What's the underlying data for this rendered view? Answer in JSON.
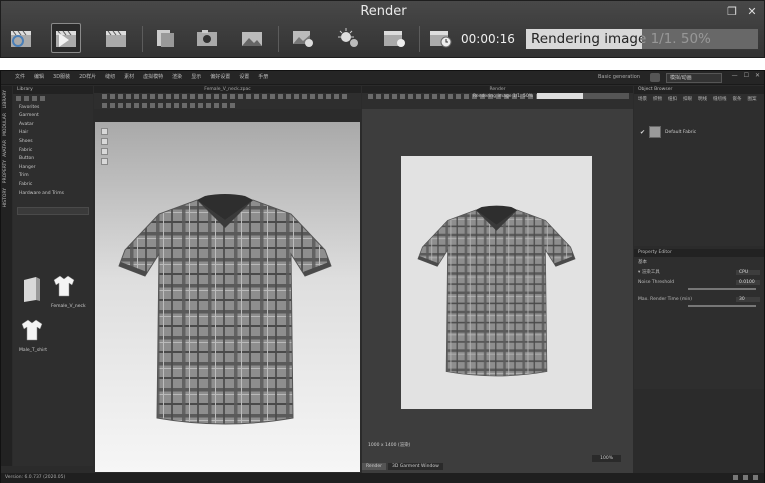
{
  "render_window": {
    "title": "Render",
    "elapsed": "00:00:16",
    "progress_text": "Rendering image 1/1. 50%",
    "progress": 0.5,
    "toolbar": [
      "sync-render-icon",
      "render-play-icon",
      "render-clip-icon",
      "copy-image-icon",
      "camera-capture-icon",
      "save-image-icon",
      "image-settings-icon",
      "light-settings-icon",
      "render-settings-icon",
      "timer-icon"
    ]
  },
  "app": {
    "menus": [
      "文件",
      "编辑",
      "3D服装",
      "2D样片",
      "缝纫",
      "素材",
      "虚拟模特",
      "渲染",
      "显示",
      "偏好设置",
      "设置",
      "手册"
    ],
    "workspace_label": "Basic generation",
    "workspace_select": "模拟/动画",
    "vertical_tabs": [
      "LIBRARY",
      "MODULAR",
      "AVATAR",
      "PROPERTY",
      "HISTORY"
    ],
    "library": {
      "header": "Library",
      "tree": [
        "Favorites",
        "Garment",
        "Avatar",
        "Hair",
        "Shoes",
        "Fabric",
        "Button",
        "Hanger",
        "Trim",
        "Fabric",
        "Hardware and Trims"
      ],
      "thumbs": [
        {
          "label": ""
        },
        {
          "label": "Female_V_neck"
        },
        {
          "label": "Male_T_shirt"
        }
      ]
    },
    "viewport3d": {
      "title": "Female_V_neck.zpac"
    },
    "renderview": {
      "title": "Render",
      "status": "Rendering image 1/1. 50%",
      "progress": 0.5,
      "size": "1000 x 1400 (渲染)",
      "zoom": "100%",
      "tabs": [
        "Render",
        "3D Garment Window"
      ]
    },
    "object_browser": {
      "header": "Object Browser",
      "tabs": [
        "场景",
        "织物",
        "纽扣",
        "扣眼",
        "明线",
        "缝纫线",
        "嵌条",
        "图案"
      ],
      "item": "Default Fabric"
    },
    "property_editor": {
      "header": "Property Editor",
      "section": "基本",
      "rows": [
        {
          "label": "▾ 渲染工具",
          "value": "CPU"
        },
        {
          "label": "Noise Threshold",
          "value": "0.0100"
        },
        {
          "label": "Max. Render Time (min)",
          "value": "30"
        }
      ]
    },
    "version": "Version: 6.0.737 (2020.05)"
  },
  "colors": {
    "plaid_base": "#8d8d8d",
    "plaid_dark": "#3f3f3f",
    "plaid_light": "#b5b5b5"
  }
}
